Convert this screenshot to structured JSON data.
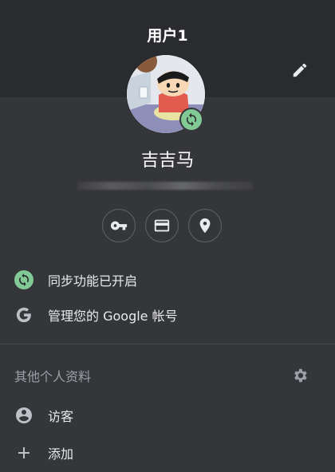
{
  "header": {
    "profile_title": "用户1"
  },
  "account": {
    "display_name": "吉吉马"
  },
  "quick_actions": [
    {
      "icon": "key-icon"
    },
    {
      "icon": "credit-card-icon"
    },
    {
      "icon": "location-pin-icon"
    }
  ],
  "menu": {
    "sync_label": "同步功能已开启",
    "manage_account_label": "管理您的 Google 帐号"
  },
  "other_profiles": {
    "section_label": "其他个人资料",
    "guest_label": "访客",
    "add_label": "添加"
  },
  "colors": {
    "background": "#35363a",
    "header_background": "#2a2b2e",
    "sync_green": "#81c995",
    "text": "#e8eaed",
    "muted_text": "#9aa0a6"
  }
}
